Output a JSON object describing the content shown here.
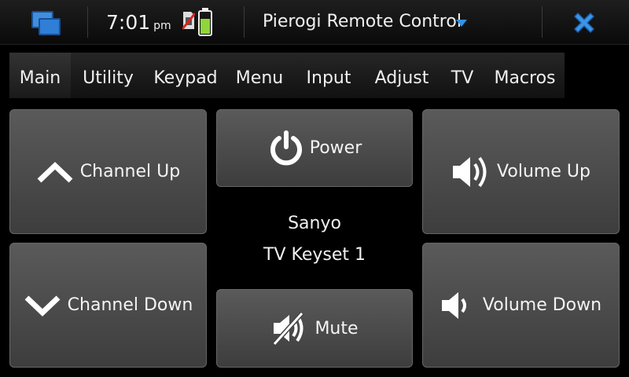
{
  "status_bar": {
    "time": "7:01",
    "ampm": "pm",
    "app_title": "Pierogi Remote Control",
    "icons": [
      "task-switcher-icon",
      "no-sim-icon",
      "battery-icon",
      "menu-dropdown-icon",
      "close-icon"
    ],
    "colors": {
      "accent": "#2f93e8",
      "battery": "#8fd63a"
    }
  },
  "tabs": [
    {
      "label": "Main",
      "active": true
    },
    {
      "label": "Utility"
    },
    {
      "label": "Keypad"
    },
    {
      "label": "Menu"
    },
    {
      "label": "Input"
    },
    {
      "label": "Adjust"
    },
    {
      "label": "TV"
    },
    {
      "label": "Macros"
    }
  ],
  "buttons": {
    "channel_up": "Channel Up",
    "channel_down": "Channel Down",
    "power": "Power",
    "mute": "Mute",
    "volume_up": "Volume Up",
    "volume_down": "Volume Down"
  },
  "device": {
    "name": "Sanyo",
    "keyset": "TV Keyset 1"
  }
}
